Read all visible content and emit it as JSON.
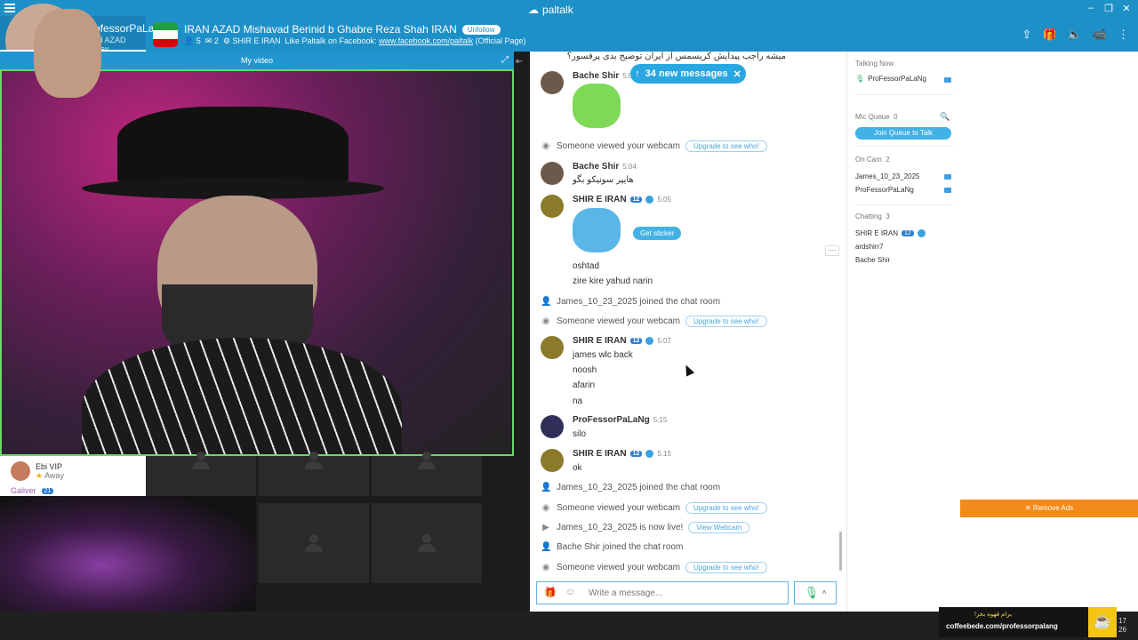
{
  "app": {
    "title": "paltalk",
    "controls": [
      "–",
      "❐",
      "✕"
    ]
  },
  "profile_tab": {
    "name": "ProfessorPaLaNg",
    "subtitle": "IRAN AZAD Mishav..."
  },
  "room": {
    "title": "IRAN AZAD Mishavad Berinid b Ghabre Reza Shah IRAN",
    "follow_button": "Unfollow",
    "users_count": "5",
    "messages_count": "2",
    "owner": "SHIR E IRAN",
    "facebook_prompt": "Like Paltalk on Facebook:",
    "facebook_link": "www.facebook.com/paltalk",
    "facebook_suffix": "(Official Page)"
  },
  "video": {
    "my_video_label": "My video"
  },
  "lower_users": [
    {
      "name": "Ebi VIP",
      "status": "Away"
    },
    {
      "name": "Galiver",
      "badge": "21"
    }
  ],
  "chat": {
    "new_messages_label": "34 new messages",
    "persian_question": "میشه راجب پیدایش کریسمس از ایران توضیح بدی پرفسور؟",
    "messages": [
      {
        "user": "Bache Shir",
        "time": "5:02"
      },
      {
        "user": "Bache Shir",
        "time": "5:04",
        "lines": [
          "هایپر سونیکو بگو"
        ]
      },
      {
        "user": "SHIR E IRAN",
        "badge": "12",
        "time": "5:05",
        "sticker_button": "Get sticker",
        "lines": [
          "oshtad",
          "zire kire yahud narin"
        ]
      },
      {
        "user": "SHIR E IRAN",
        "badge": "12",
        "time": "5:07",
        "lines": [
          "james wlc back",
          "noosh",
          "afarin",
          "na"
        ]
      },
      {
        "user": "ProFessorPaLaNg",
        "time": "5:15",
        "lines": [
          "silo"
        ]
      },
      {
        "user": "SHIR E IRAN",
        "badge": "12",
        "time": "5:15",
        "lines": [
          "ok"
        ]
      }
    ],
    "system": {
      "viewed_webcam": "Someone viewed your webcam",
      "upgrade_pill": "Upgrade to see who!",
      "joined_1": "James_10_23_2025 joined the chat room",
      "joined_2": "James_10_23_2025 joined the chat room",
      "live": "James_10_23_2025 is now live!",
      "view_webcam_pill": "View Webcam",
      "joined_3": "Bache Shir joined the chat room"
    },
    "composer_placeholder": "Write a message..."
  },
  "sidepanel": {
    "talking_now_label": "Talking Now",
    "talking_now_user": "ProFessorPaLaNg",
    "mic_queue_label": "Mic Queue",
    "mic_queue_count": "0",
    "join_queue_button": "Join Queue to Talk",
    "on_cam_label": "On Cam",
    "on_cam_count": "2",
    "on_cam_users": [
      "James_10_23_2025",
      "ProFessorPaLaNg"
    ],
    "chatting_label": "Chatting",
    "chatting_count": "3",
    "chatting_users": [
      {
        "name": "SHIR E IRAN",
        "badge": "12"
      },
      {
        "name": "ardshirr7"
      },
      {
        "name": "Bache Shir"
      }
    ]
  },
  "ads": {
    "remove_label": "✕ Remove Ads"
  },
  "coffee_banner": {
    "top_text": "برام قهوه بخر!",
    "url": "coffeebede.com/professorpalang"
  },
  "taskbar": {
    "clock_top": "17",
    "clock_bottom": "26"
  },
  "colors": {
    "brand_blue": "#1e90c8",
    "active_green": "#6bd66b",
    "orange": "#f28b1b"
  }
}
